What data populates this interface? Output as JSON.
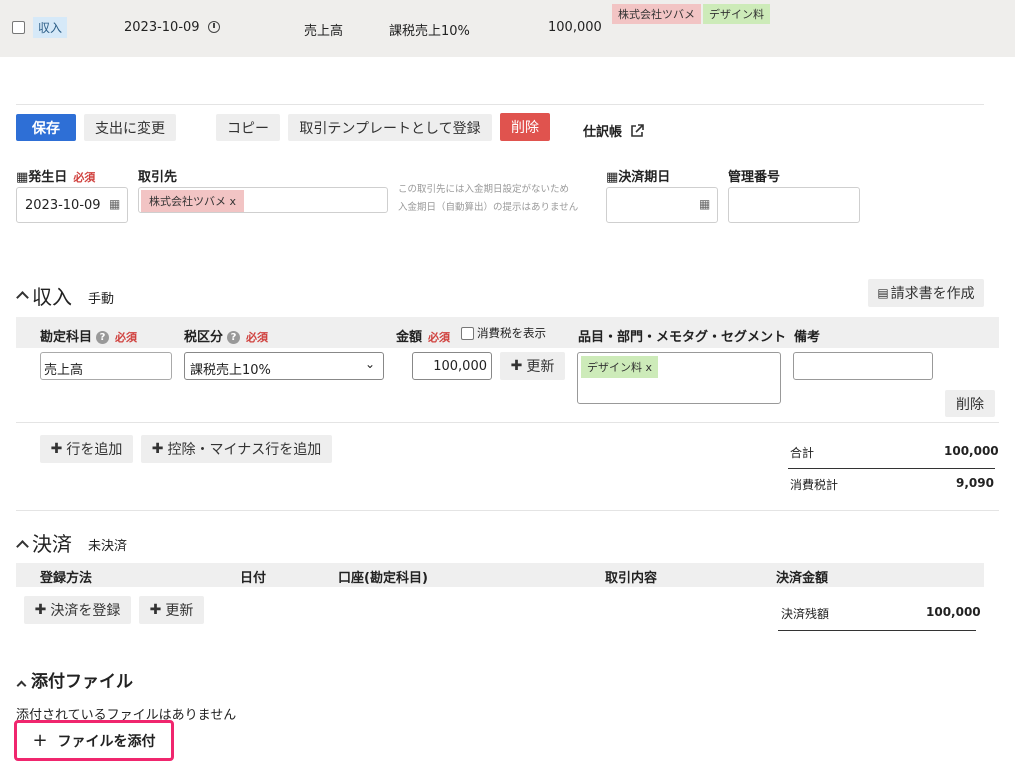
{
  "top_row": {
    "type_badge": "収入",
    "date": "2023-10-09",
    "account": "売上高",
    "tax": "課税売上10%",
    "amount": "100,000",
    "partner_tag": "株式会社ツバメ",
    "item_tag": "デザイン料"
  },
  "toolbar": {
    "save": "保存",
    "change_to_expense": "支出に変更",
    "copy": "コピー",
    "register_template": "取引テンプレートとして登録",
    "delete": "削除",
    "journal": "仕訳帳"
  },
  "form": {
    "issue_date_label": "発生日",
    "required": "必須",
    "issue_date_value": "2023-10-09",
    "partner_label": "取引先",
    "partner_value": "株式会社ツバメ",
    "partner_note_1": "この取引先には入金期日設定がないため",
    "partner_note_2": "入金期日（自動算出）の提示はありません",
    "due_date_label": "決済期日",
    "mgmt_no_label": "管理番号"
  },
  "income": {
    "title": "収入",
    "mode": "手動",
    "invoice_button": "請求書を作成",
    "col_account": "勘定科目",
    "col_tax": "税区分",
    "col_amount": "金額",
    "show_tax_label": "消費税を表示",
    "col_items": "品目・部門・メモタグ・セグメント",
    "col_note": "備考",
    "account_value": "売上高",
    "tax_value": "課税売上10%",
    "amount_value": "100,000",
    "update_button": "更新",
    "item_tag": "デザイン料",
    "delete_row": "削除",
    "add_row": "行を追加",
    "add_deduct_row": "控除・マイナス行を追加",
    "total_label": "合計",
    "total_value": "100,000",
    "tax_total_label": "消費税計",
    "tax_total_value": "9,090"
  },
  "settlement": {
    "title": "決済",
    "status": "未決済",
    "col_method": "登録方法",
    "col_date": "日付",
    "col_account": "口座(勘定科目)",
    "col_content": "取引内容",
    "col_amount": "決済金額",
    "register_button": "決済を登録",
    "update_button": "更新",
    "balance_label": "決済残額",
    "balance_value": "100,000"
  },
  "attachments": {
    "title": "添付ファイル",
    "empty_text": "添付されているファイルはありません",
    "attach_button": "ファイルを添付"
  },
  "colors": {
    "primary": "#2e6fd6",
    "danger": "#e0534e",
    "highlight": "#f0266e"
  }
}
